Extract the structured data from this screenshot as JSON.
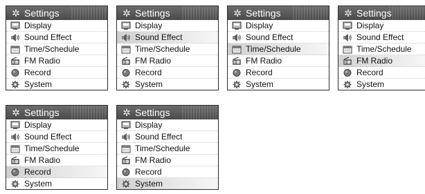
{
  "panels": [
    {
      "title": "Settings",
      "selected": 0,
      "items": [
        "Display",
        "Sound Effect",
        "Time/Schedule",
        "FM Radio",
        "Record",
        "System"
      ]
    },
    {
      "title": "Settings",
      "selected": 1,
      "items": [
        "Display",
        "Sound Effect",
        "Time/Schedule",
        "FM Radio",
        "Record",
        "System"
      ]
    },
    {
      "title": "Settings",
      "selected": 2,
      "items": [
        "Display",
        "Sound Effect",
        "Time/Schedule",
        "FM Radio",
        "Record",
        "System"
      ]
    },
    {
      "title": "Settings",
      "selected": 3,
      "items": [
        "Display",
        "Sound Effect",
        "Time/Schedule",
        "FM Radio",
        "Record",
        "System"
      ]
    },
    {
      "title": "Settings",
      "selected": 4,
      "items": [
        "Display",
        "Sound Effect",
        "Time/Schedule",
        "FM Radio",
        "Record",
        "System"
      ]
    },
    {
      "title": "Settings",
      "selected": 5,
      "items": [
        "Display",
        "Sound Effect",
        "Time/Schedule",
        "FM Radio",
        "Record",
        "System"
      ]
    }
  ],
  "icons": [
    "display-icon",
    "sound-effect-icon",
    "calendar-icon",
    "radio-icon",
    "record-icon",
    "system-icon"
  ]
}
